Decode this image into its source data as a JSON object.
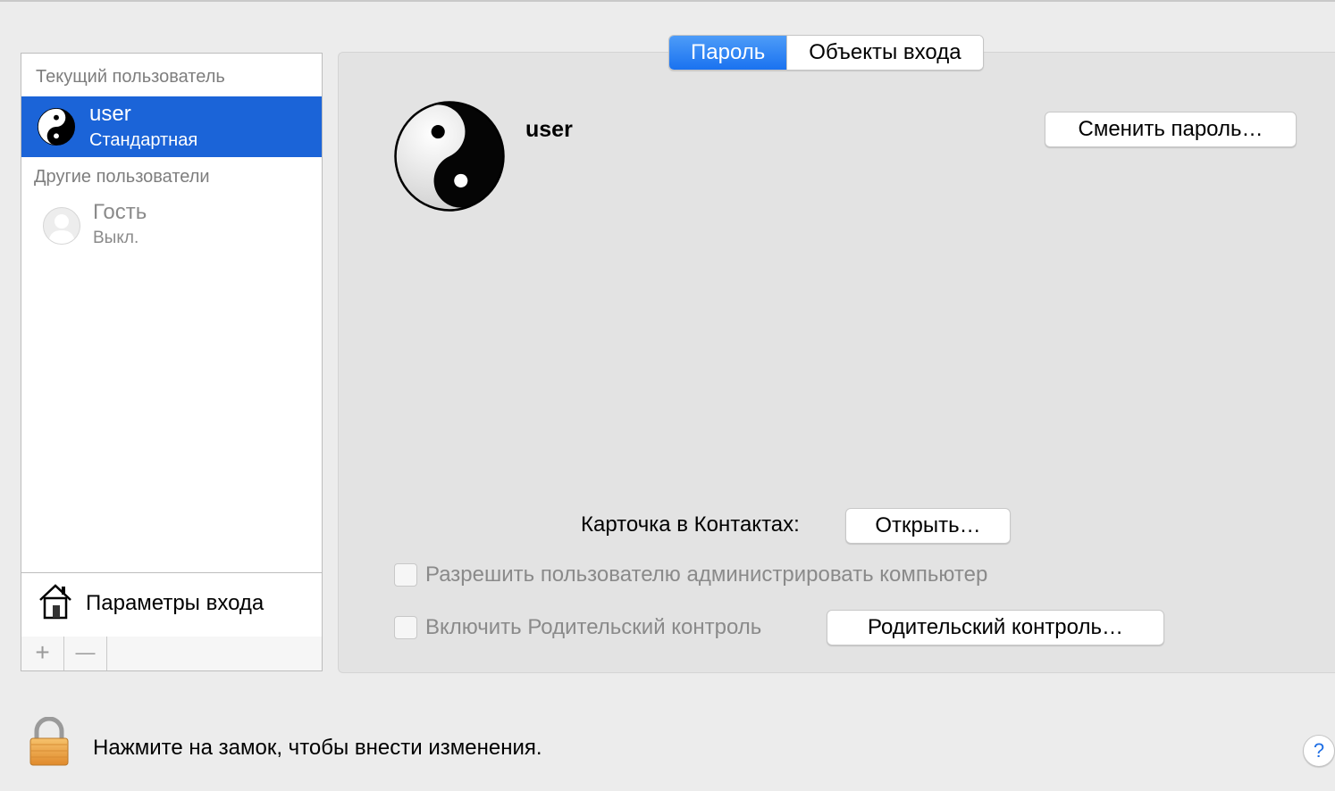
{
  "sidebar": {
    "current_user_header": "Текущий пользователь",
    "current_user": {
      "name": "user",
      "type": "Стандартная",
      "avatar": "yin-yang-icon"
    },
    "other_users_header": "Другие пользователи",
    "guest": {
      "name": "Гость",
      "status": "Выкл.",
      "avatar": "person-silhouette-icon"
    },
    "login_options_label": "Параметры входа",
    "add_label": "+",
    "remove_label": "—"
  },
  "tabs": [
    {
      "label": "Пароль",
      "active": true
    },
    {
      "label": "Объекты входа",
      "active": false
    }
  ],
  "main": {
    "user_name": "user",
    "change_password_label": "Сменить пароль…",
    "contacts_card_label": "Карточка в Контактах:",
    "open_label": "Открыть…",
    "allow_admin_label": "Разрешить пользователю администрировать компьютер",
    "allow_admin_checked": false,
    "parental_control_label": "Включить Родительский контроль",
    "parental_control_checked": false,
    "parental_control_button_label": "Родительский контроль…"
  },
  "footer": {
    "lock_text": "Нажмите на замок, чтобы внести изменения.",
    "help_label": "?"
  },
  "colors": {
    "selection": "#1b64d8",
    "tab_active": "#1a72f0",
    "panel_bg": "#e3e3e3",
    "window_bg": "#ececec"
  }
}
